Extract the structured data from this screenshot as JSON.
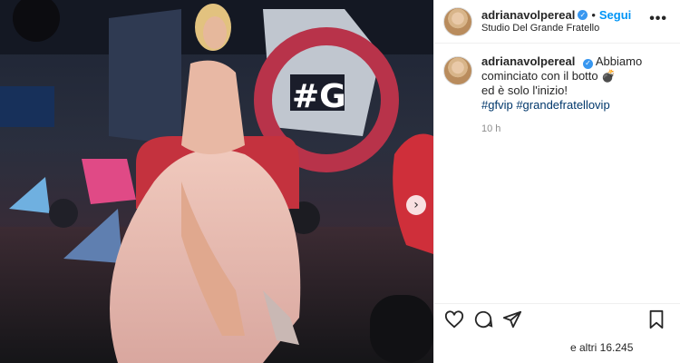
{
  "post": {
    "username": "adrianavolpereal",
    "follow_label": "Segui",
    "separator": "•",
    "location": "Studio Del Grande Fratello",
    "more_label": "•••",
    "caption_line1": "Abbiamo cominciato con il botto 💣",
    "caption_line2": "ed è solo l'inizio!",
    "hashtags": [
      "#gfvip",
      "#grandefratellovip"
    ],
    "time": "10 h",
    "likes": "e altri 16.245"
  },
  "icons": {
    "verified": "verified-badge-icon",
    "next": "chevron-right-icon",
    "like": "heart-icon",
    "comment": "comment-icon",
    "share": "paper-plane-icon",
    "save": "bookmark-icon"
  },
  "media": {
    "sign_text": "#G"
  },
  "colors": {
    "follow": "#0095f6",
    "hashtag": "#00376b",
    "verified": "#3897f0",
    "dress": "#e8b8b0"
  }
}
